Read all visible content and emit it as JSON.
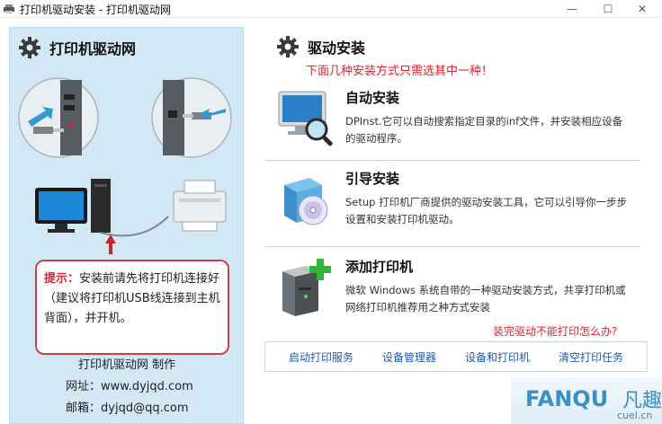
{
  "window": {
    "title": "打印机驱动安装 - 打印机驱动网"
  },
  "window_controls": {
    "minimize": "—",
    "maximize": "☐",
    "close": "✕"
  },
  "left_panel": {
    "title": "打印机驱动网",
    "tip_label": "提示：",
    "tip_text": "安装前请先将打印机连接好（建议将打印机USB线连接到主机背面），并开机。",
    "credits": {
      "maker": "打印机驱动网  制作",
      "website_label": "网址：",
      "website": "www.dyjqd.com",
      "email_label": "邮箱：",
      "email": "dyjqd@qq.com"
    }
  },
  "right_panel": {
    "title": "驱动安装",
    "subtitle": "下面几种安装方式只需选其中一种！",
    "options": [
      {
        "title": "自动安装",
        "desc": "DPInst.它可以自动搜索指定目录的inf文件，并安装相应设备的驱动程序。",
        "icon": "monitor-magnifier-icon"
      },
      {
        "title": "引导安装",
        "desc": "Setup 打印机厂商提供的驱动安装工具，它可以引导你一步步设置和安装打印机驱动。",
        "icon": "setup-box-cd-icon"
      },
      {
        "title": "添加打印机",
        "desc": "微软 Windows 系统自带的一种驱动安装方式，共享打印机或网络打印机推荐用之种方式安装",
        "icon": "add-printer-icon"
      }
    ],
    "help_link": "装完驱动不能打印怎么办?",
    "bottom_links": [
      "启动打印服务",
      "设备管理器",
      "设备和打印机",
      "清空打印任务"
    ]
  },
  "watermark": {
    "brand_en": "FANQU",
    "brand_cn": "凡趣",
    "url": "cuel.cn"
  },
  "colors": {
    "left_bg": "#d3e8f5",
    "accent_red": "#e0202b",
    "link_blue": "#1a5bb8",
    "watermark_blue": "#3b8fc9"
  }
}
